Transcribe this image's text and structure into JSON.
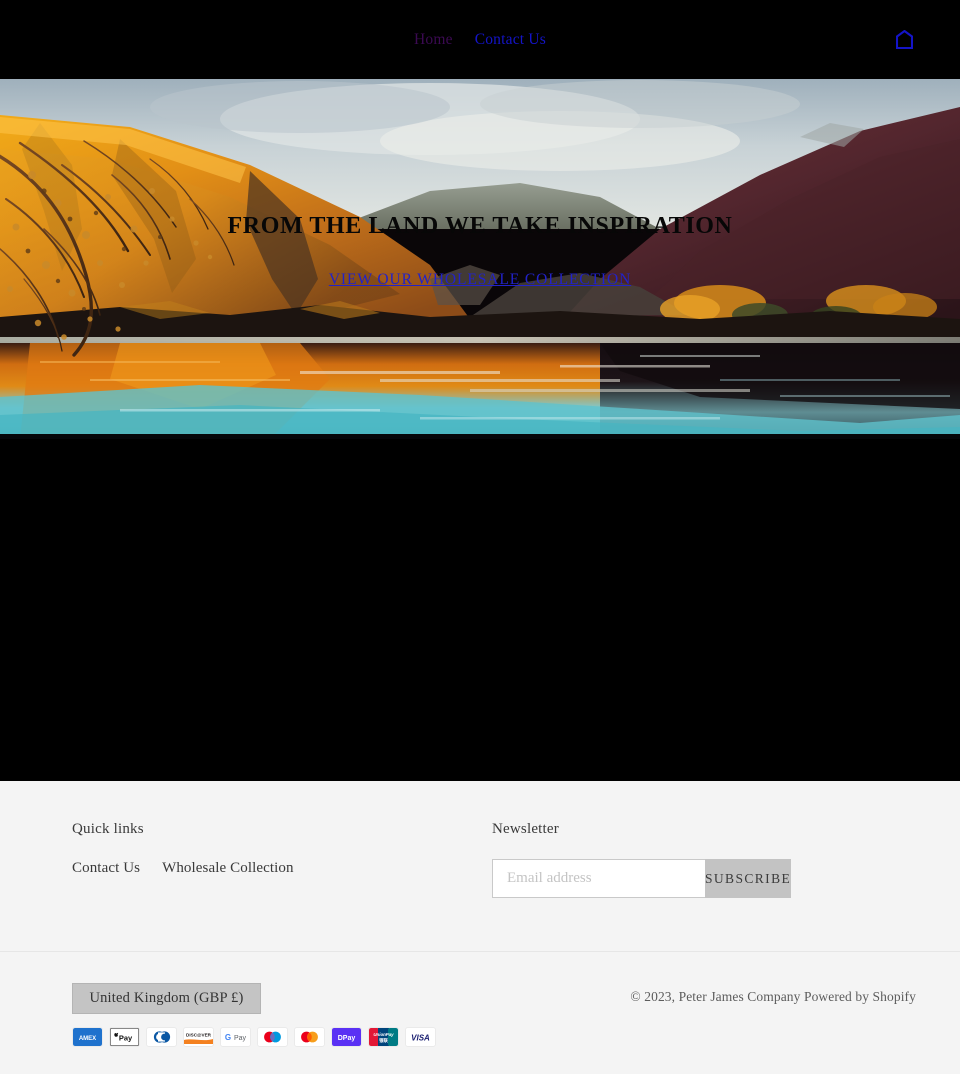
{
  "header": {
    "nav": [
      {
        "label": "Home",
        "state": "visited"
      },
      {
        "label": "Contact Us",
        "state": "unvisited"
      }
    ],
    "cart_icon": "shopping-bag-icon",
    "cart_icon_color": "#1414c8",
    "background": "#000000"
  },
  "hero": {
    "title": "FROM THE LAND WE TAKE INSPIRATION",
    "cta_label": "VIEW OUR WHOLESALE COLLECTION",
    "title_color": "#070707",
    "cta_color": "#2222c9",
    "image_description": "autumn golden hillside above a still lake with orange and turquoise reflections"
  },
  "footer": {
    "quick_links": {
      "heading": "Quick links",
      "items": [
        {
          "label": "Contact Us"
        },
        {
          "label": "Wholesale Collection"
        }
      ]
    },
    "newsletter": {
      "heading": "Newsletter",
      "input_placeholder": "Email address",
      "input_value": "",
      "submit_label": "SUBSCRIBE"
    },
    "locale": {
      "selected": "United Kingdom (GBP £)"
    },
    "copyright": "© 2023, Peter James Company Powered by Shopify",
    "payment_methods": [
      {
        "name": "american-express",
        "label": "AMEX"
      },
      {
        "name": "apple-pay",
        "label": "Apple Pay"
      },
      {
        "name": "diners-club",
        "label": "Diners Club"
      },
      {
        "name": "discover",
        "label": "DISCOVER"
      },
      {
        "name": "google-pay",
        "label": "G Pay"
      },
      {
        "name": "maestro",
        "label": "Maestro"
      },
      {
        "name": "mastercard",
        "label": "Mastercard"
      },
      {
        "name": "shop-pay",
        "label": "DPay"
      },
      {
        "name": "union-pay",
        "label": "UnionPay"
      },
      {
        "name": "visa",
        "label": "VISA"
      }
    ],
    "background": "#f4f4f4"
  }
}
